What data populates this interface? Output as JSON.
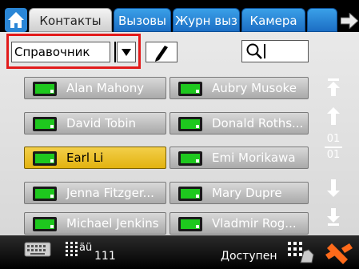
{
  "tabs": [
    {
      "label": "Контакты",
      "active": true
    },
    {
      "label": "Вызовы",
      "active": false
    },
    {
      "label": "Журн выз",
      "active": false
    },
    {
      "label": "Камера",
      "active": false
    }
  ],
  "toolbar": {
    "directory_select_value": "Справочник",
    "search_value": ""
  },
  "contacts": [
    {
      "name": "Alan Mahony"
    },
    {
      "name": "Aubry Musoke"
    },
    {
      "name": "David Tobin"
    },
    {
      "name": "Donald Roths..."
    },
    {
      "name": "Earl Li",
      "selected": true
    },
    {
      "name": "Emi Morikawa"
    },
    {
      "name": "Jenna Fitzger..."
    },
    {
      "name": "Mary Dupre"
    },
    {
      "name": "Michael Jenkins"
    },
    {
      "name": "Vladmir Rog..."
    }
  ],
  "pager": {
    "current": "01",
    "total": "01"
  },
  "statusbar": {
    "extension": "111",
    "keypad_text": "äü",
    "status": "Доступен"
  },
  "colors": {
    "tab_active": "#e6e6e6",
    "tab_inactive": "#2a86d6",
    "highlight": "#e8bd1e",
    "highlight_outline": "#e21a1a",
    "status_green": "#1ec81e"
  }
}
